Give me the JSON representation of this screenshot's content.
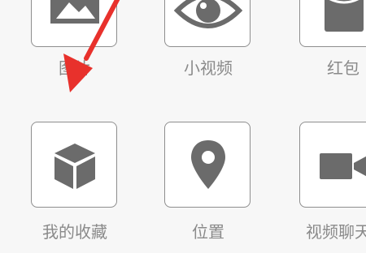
{
  "grid": {
    "row1": [
      {
        "label": "图片",
        "icon": "image-icon"
      },
      {
        "label": "小视频",
        "icon": "eye-icon"
      },
      {
        "label": "红包",
        "icon": "red-packet-icon"
      }
    ],
    "row2": [
      {
        "label": "我的收藏",
        "icon": "cube-icon"
      },
      {
        "label": "位置",
        "icon": "location-pin-icon"
      },
      {
        "label": "视频聊天",
        "icon": "video-camera-icon"
      }
    ]
  },
  "annotation": {
    "icon": "red-arrow-icon",
    "color": "#e8312c"
  },
  "colors": {
    "icon": "#6b6b6b",
    "label": "#8a8a8a",
    "tile_border": "#8e8e8e",
    "background": "#f7f7f7"
  }
}
